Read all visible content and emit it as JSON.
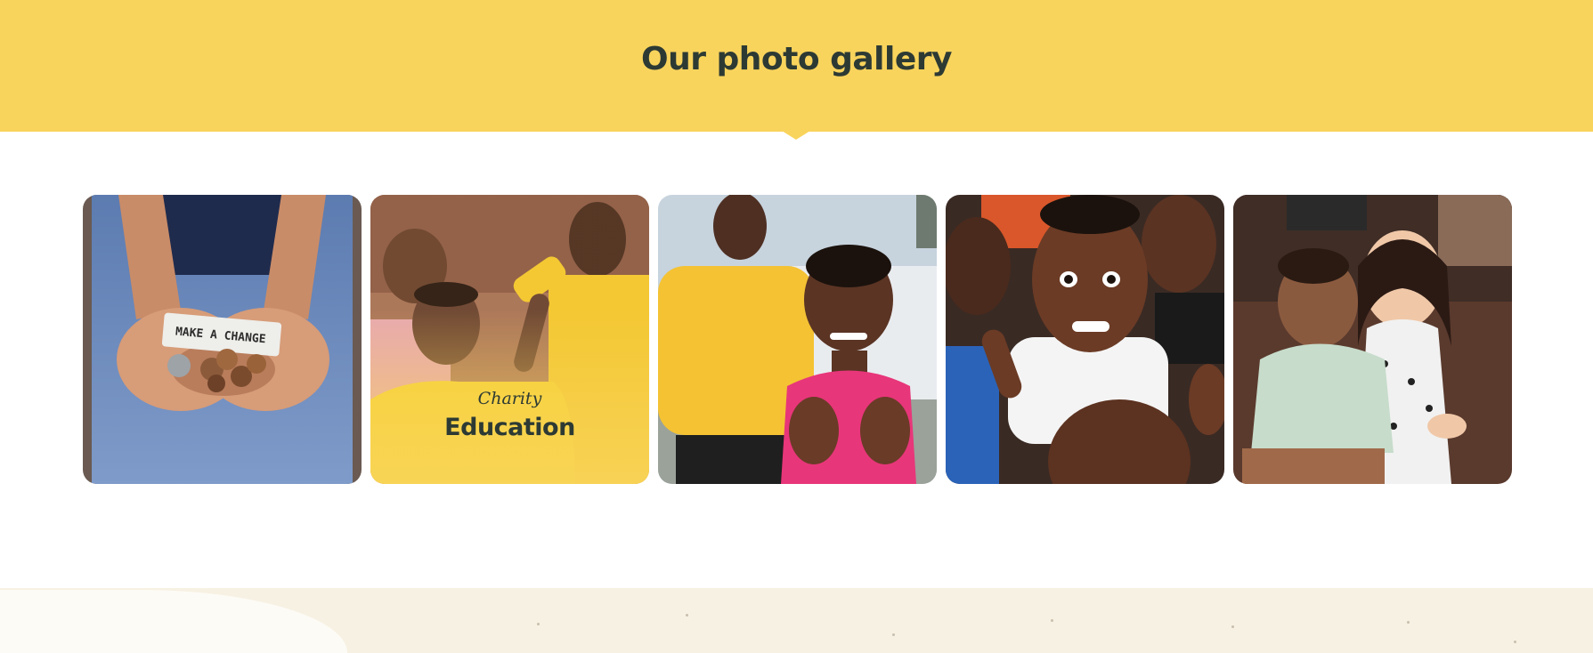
{
  "header": {
    "title": "Our photo gallery",
    "background_color": "#f9d45c"
  },
  "gallery": {
    "items": [
      {
        "id": "coins",
        "note_text": "MAKE A CHANGE"
      },
      {
        "id": "education",
        "tag": "Charity",
        "heading": "Education"
      },
      {
        "id": "smiling-girl"
      },
      {
        "id": "group-kids"
      },
      {
        "id": "siblings"
      }
    ]
  },
  "colors": {
    "accent": "#f9d45c",
    "text_dark": "#2d3a34",
    "footer_band": "#f7f1e3"
  }
}
